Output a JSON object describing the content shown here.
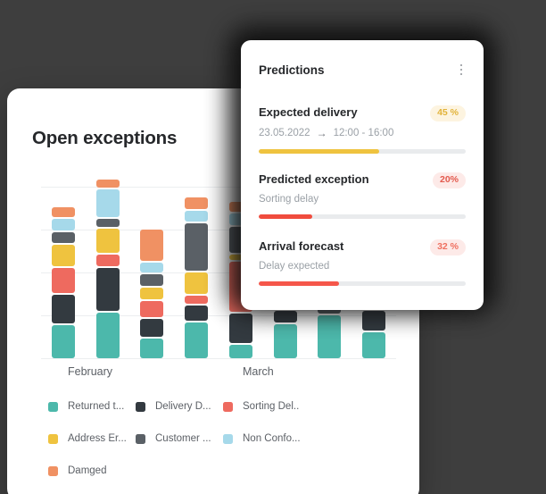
{
  "theme": {
    "background": "#3e3e3e",
    "card_background": "#ffffff",
    "text_primary": "#26282b",
    "text_secondary": "#5c6066",
    "text_muted": "#9aa0a6",
    "gridline": "#eceef0",
    "track": "#e9ebed"
  },
  "exceptions": {
    "title": "Open exceptions",
    "axis_labels": [
      "February",
      "March"
    ],
    "legend": [
      {
        "label": "Returned t...",
        "color": "#4cb8ab",
        "key": "returned"
      },
      {
        "label": "Delivery D...",
        "color": "#333a40",
        "key": "delivery-damage"
      },
      {
        "label": "Sorting Del..",
        "color": "#ee6a5f",
        "key": "sorting-delay"
      },
      {
        "label": "Address Er...",
        "color": "#efc33f",
        "key": "address-error"
      },
      {
        "label": "Customer ...",
        "color": "#5a6066",
        "key": "customer"
      },
      {
        "label": "Non Confo...",
        "color": "#a6d9ea",
        "key": "non-conformity"
      },
      {
        "label": "Damged",
        "color": "#f09163",
        "key": "damaged"
      }
    ]
  },
  "chart_data": {
    "type": "bar",
    "subtype": "stacked",
    "title": "Open exceptions",
    "xlabel": "",
    "ylabel": "",
    "grid": true,
    "gridlines": 5,
    "categories": [
      "February",
      "March"
    ],
    "bar_count": 8,
    "series": [
      {
        "name": "Returned t...",
        "color": "#4cb8ab",
        "values": [
          40,
          56,
          24,
          44,
          16,
          42,
          52,
          32
        ]
      },
      {
        "name": "Delivery D...",
        "color": "#333a40",
        "values": [
          36,
          52,
          22,
          18,
          36,
          14,
          0,
          24
        ]
      },
      {
        "name": "Sorting Del..",
        "color": "#ee6a5f",
        "values": [
          30,
          14,
          20,
          10,
          62,
          0,
          0,
          10
        ]
      },
      {
        "name": "Address Er...",
        "color": "#efc33f",
        "values": [
          26,
          30,
          14,
          26,
          6,
          0,
          0,
          0
        ]
      },
      {
        "name": "Customer ...",
        "color": "#5a6066",
        "values": [
          14,
          10,
          14,
          58,
          32,
          14,
          10,
          0
        ]
      },
      {
        "name": "Non Confo...",
        "color": "#a6d9ea",
        "values": [
          14,
          34,
          12,
          14,
          14,
          0,
          0,
          0
        ]
      },
      {
        "name": "Damged",
        "color": "#f09163",
        "values": [
          12,
          10,
          38,
          14,
          12,
          0,
          0,
          0
        ]
      }
    ]
  },
  "predictions": {
    "title": "Predictions",
    "menu_icon": "kebab-menu-icon",
    "items": [
      {
        "name": "Expected delivery",
        "badge": "45 %",
        "badge_color": "#e2b33a",
        "badge_bg": "#fdf4e0",
        "sub_left": "23.05.2022",
        "arrow": "→",
        "sub_right": "12:00 - 16:00",
        "progress": 58,
        "progress_color": "#efc33f"
      },
      {
        "name": "Predicted exception",
        "badge": "20%",
        "badge_color": "#e35a4e",
        "badge_bg": "#fdeae8",
        "sub_left": "Sorting delay",
        "arrow": "",
        "sub_right": "",
        "progress": 26,
        "progress_color": "#f04c3e"
      },
      {
        "name": "Arrival forecast",
        "badge": "32 %",
        "badge_color": "#ef7060",
        "badge_bg": "#fdeae8",
        "sub_left": "Delay expected",
        "arrow": "",
        "sub_right": "",
        "progress": 39,
        "progress_color": "#f5564a"
      }
    ]
  }
}
